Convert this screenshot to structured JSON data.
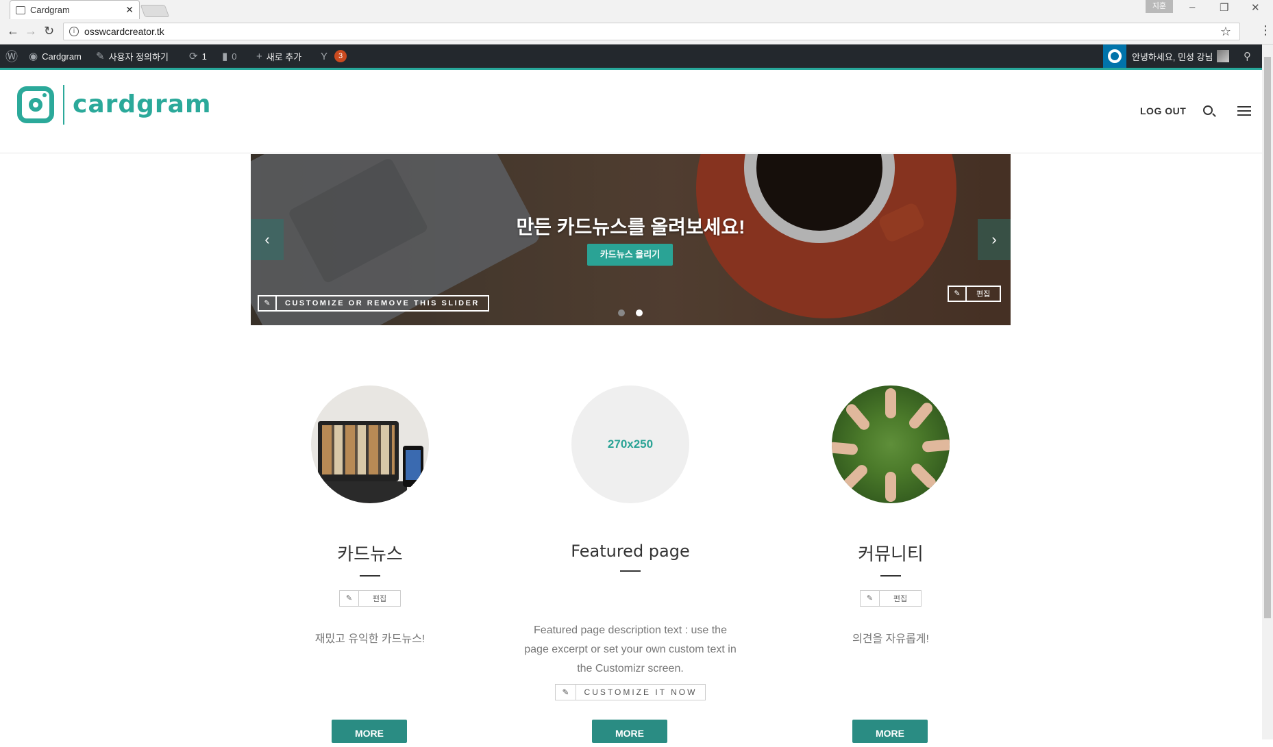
{
  "browser": {
    "tab_title": "Cardgram",
    "tab_close": "✕",
    "profile": "지훈",
    "url": "osswcardcreator.tk"
  },
  "adminbar": {
    "site_name": "Cardgram",
    "customize": "사용자 정의하기",
    "updates": "1",
    "comments": "0",
    "new": "새로 추가",
    "yoast_count": "3",
    "greeting": "안녕하세요, 민성 강님"
  },
  "header": {
    "logo_text": "cardgram",
    "logout": "LOG OUT"
  },
  "slider": {
    "title": "만든 카드뉴스를 올려보세요!",
    "button": "카드뉴스 올리기",
    "customize": "CUSTOMIZE OR REMOVE THIS SLIDER",
    "edit": "편집",
    "prev": "‹",
    "next": "›"
  },
  "featured": [
    {
      "title": "카드뉴스",
      "edit": "편집",
      "desc": "재밌고 유익한 카드뉴스!",
      "more": "MORE"
    },
    {
      "placeholder": "270x250",
      "title": "Featured page",
      "desc_lines": [
        "Featured page description text : use the",
        "page excerpt or set your own custom text in",
        "the Customizr screen."
      ],
      "customize": "CUSTOMIZE IT NOW",
      "more": "MORE"
    },
    {
      "title": "커뮤니티",
      "edit": "편집",
      "desc": "의견을 자유롭게!",
      "more": "MORE"
    }
  ],
  "colors": {
    "accent": "#2ba99a",
    "adminbar": "#23282d",
    "button": "#2a8c83"
  }
}
